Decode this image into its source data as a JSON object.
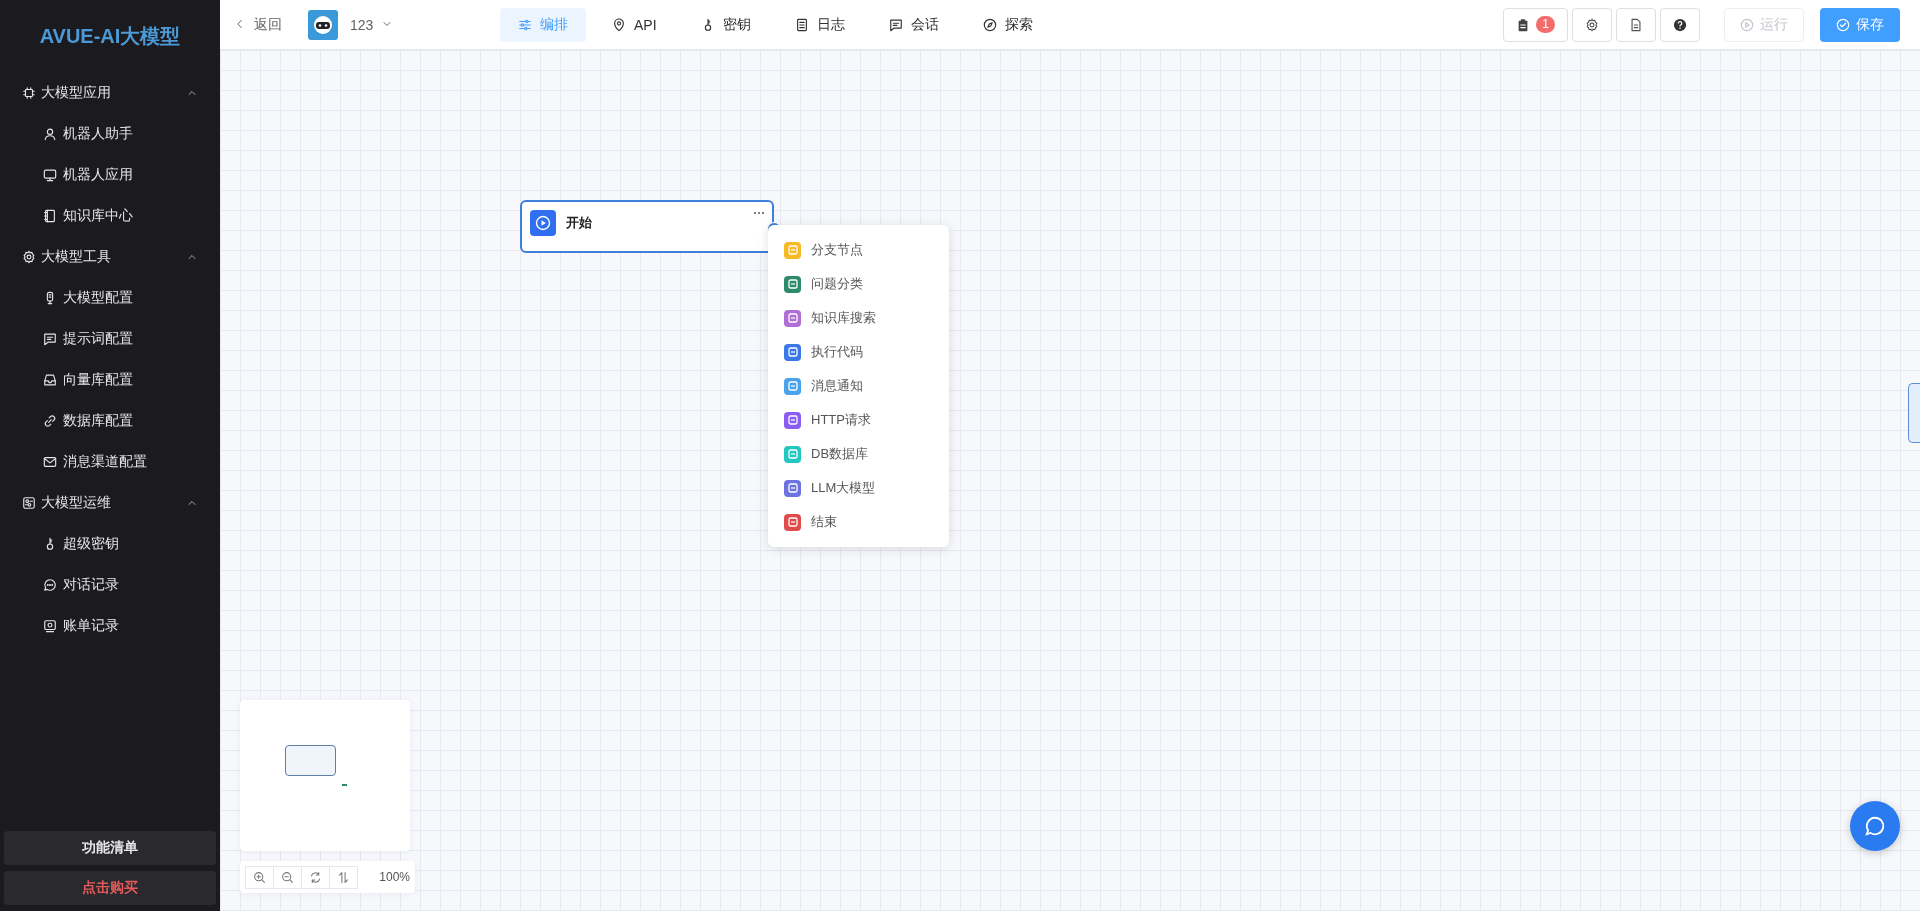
{
  "sidebar": {
    "title": "AVUE-AI大模型",
    "groups": [
      {
        "label": "大模型应用",
        "expanded": true,
        "items": [
          {
            "label": "机器人助手"
          },
          {
            "label": "机器人应用"
          },
          {
            "label": "知识库中心"
          }
        ]
      },
      {
        "label": "大模型工具",
        "expanded": true,
        "items": [
          {
            "label": "大模型配置"
          },
          {
            "label": "提示词配置"
          },
          {
            "label": "向量库配置"
          },
          {
            "label": "数据库配置"
          },
          {
            "label": "消息渠道配置"
          }
        ]
      },
      {
        "label": "大模型运维",
        "expanded": true,
        "items": [
          {
            "label": "超级密钥"
          },
          {
            "label": "对话记录"
          },
          {
            "label": "账单记录"
          }
        ]
      }
    ],
    "footer_buttons": [
      {
        "label": "功能清单",
        "kind": "normal"
      },
      {
        "label": "点击购买",
        "kind": "danger"
      }
    ]
  },
  "toolbar": {
    "back": "返回",
    "app_name": "123",
    "tabs": [
      {
        "label": "编排",
        "selected": true
      },
      {
        "label": "API",
        "selected": false
      },
      {
        "label": "密钥",
        "selected": false
      },
      {
        "label": "日志",
        "selected": false
      },
      {
        "label": "会话",
        "selected": false
      },
      {
        "label": "探索",
        "selected": false
      }
    ],
    "notes_badge": "1",
    "run": {
      "label": "运行",
      "disabled": true
    },
    "save": {
      "label": "保存"
    }
  },
  "canvas": {
    "node": {
      "title": "开始"
    },
    "node_menu": [
      {
        "label": "分支节点",
        "color": "#f7b924"
      },
      {
        "label": "问题分类",
        "color": "#2e8b6a"
      },
      {
        "label": "知识库搜索",
        "color": "#b06fd6"
      },
      {
        "label": "执行代码",
        "color": "#3b78e7"
      },
      {
        "label": "消息通知",
        "color": "#4aa3ea"
      },
      {
        "label": "HTTP请求",
        "color": "#8a5cf0"
      },
      {
        "label": "DB数据库",
        "color": "#22c7c0"
      },
      {
        "label": "LLM大模型",
        "color": "#6b73e0"
      },
      {
        "label": "结束",
        "color": "#e04b4b"
      }
    ],
    "zoom_level": "100%"
  }
}
